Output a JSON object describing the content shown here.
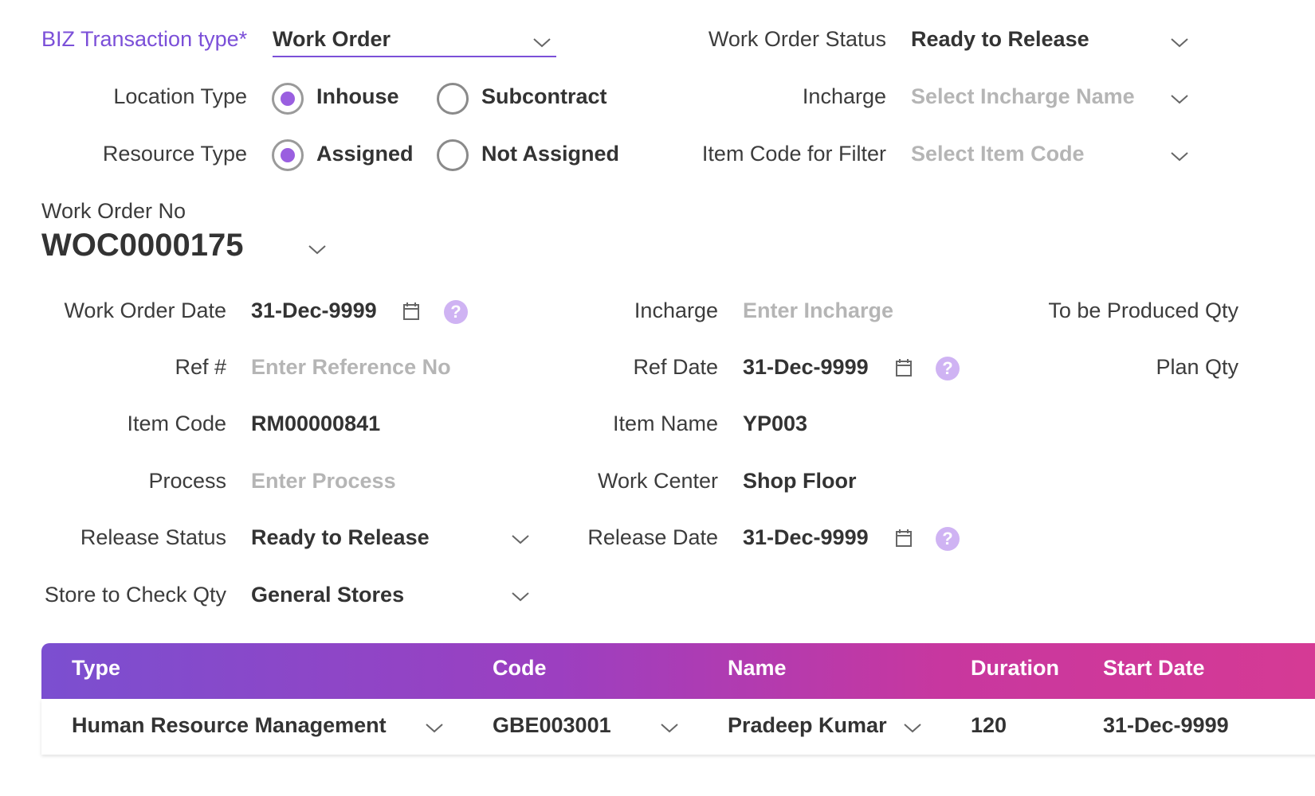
{
  "header": {
    "biz_label": "BIZ Transaction type*",
    "biz_value": "Work Order",
    "wo_status_label": "Work Order Status",
    "wo_status_value": "Ready to Release",
    "location_label": "Location Type",
    "location_options": [
      "Inhouse",
      "Subcontract"
    ],
    "location_selected": "Inhouse",
    "incharge_label": "Incharge",
    "incharge_placeholder": "Select Incharge Name",
    "resource_label": "Resource Type",
    "resource_options": [
      "Assigned",
      "Not Assigned"
    ],
    "resource_selected": "Assigned",
    "itemcode_filter_label": "Item Code for Filter",
    "itemcode_filter_placeholder": "Select Item Code"
  },
  "work_order": {
    "no_label": "Work Order No",
    "no_value": "WOC0000175"
  },
  "form": {
    "wo_date_label": "Work Order Date",
    "wo_date_value": "31-Dec-9999",
    "incharge_label": "Incharge",
    "incharge_placeholder": "Enter Incharge",
    "to_be_produced_label": "To be Produced Qty",
    "ref_label": "Ref #",
    "ref_placeholder": "Enter Reference No",
    "ref_date_label": "Ref Date",
    "ref_date_value": "31-Dec-9999",
    "plan_qty_label": "Plan Qty",
    "item_code_label": "Item Code",
    "item_code_value": "RM00000841",
    "item_name_label": "Item Name",
    "item_name_value": "YP003",
    "process_label": "Process",
    "process_placeholder": "Enter Process",
    "work_center_label": "Work Center",
    "work_center_value": "Shop Floor",
    "release_status_label": "Release Status",
    "release_status_value": "Ready to Release",
    "release_date_label": "Release Date",
    "release_date_value": "31-Dec-9999",
    "store_label": "Store to Check Qty",
    "store_value": "General Stores"
  },
  "table": {
    "columns": [
      "Type",
      "Code",
      "Name",
      "Duration",
      "Start Date"
    ],
    "rows": [
      {
        "type": "Human Resource Management",
        "code": "GBE003001",
        "name": "Pradeep Kumar",
        "duration": "120",
        "start_date": "31-Dec-9999"
      }
    ]
  },
  "icons": {
    "chevron": "chevron-down-icon",
    "calendar": "calendar-icon",
    "help": "help-icon"
  },
  "colors": {
    "accent": "#7b4fd8",
    "radio_dot": "#9a5fe0",
    "help_bg": "#cfb3f3",
    "header_gradient_start": "#7b4fd0",
    "header_gradient_end": "#d63a94"
  }
}
